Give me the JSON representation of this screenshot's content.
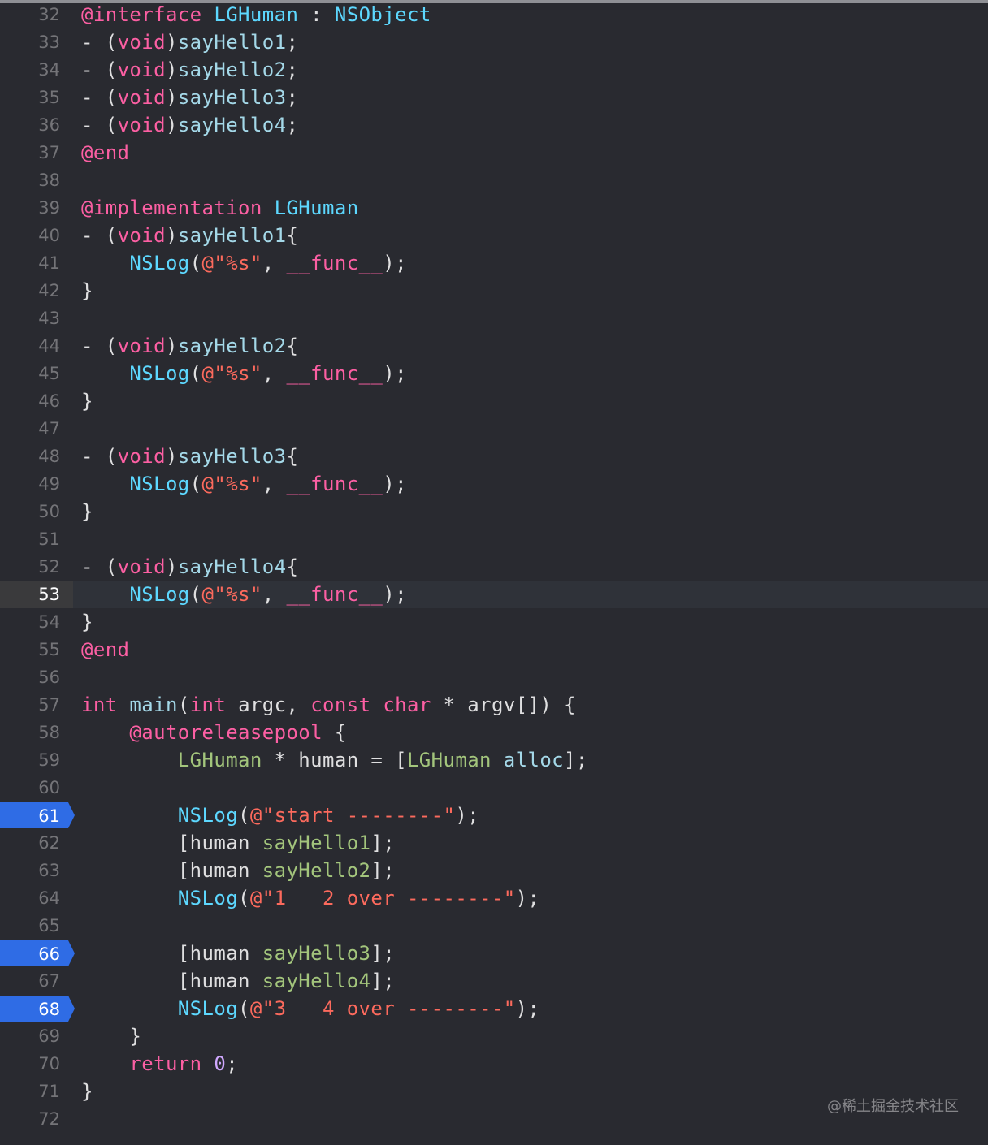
{
  "editor": {
    "current_line": 53,
    "breakpoint_lines": [
      61,
      66,
      68
    ],
    "lines": [
      {
        "n": "32",
        "tokens": [
          [
            "kw",
            "@interface"
          ],
          [
            "p",
            " "
          ],
          [
            "lg",
            "LGHuman"
          ],
          [
            "p",
            " : "
          ],
          [
            "cls",
            "NSObject"
          ]
        ]
      },
      {
        "n": "33",
        "tokens": [
          [
            "p",
            "- ("
          ],
          [
            "kw",
            "void"
          ],
          [
            "p",
            ")"
          ],
          [
            "meth",
            "sayHello1"
          ],
          [
            "p",
            ";"
          ]
        ]
      },
      {
        "n": "34",
        "tokens": [
          [
            "p",
            "- ("
          ],
          [
            "kw",
            "void"
          ],
          [
            "p",
            ")"
          ],
          [
            "meth",
            "sayHello2"
          ],
          [
            "p",
            ";"
          ]
        ]
      },
      {
        "n": "35",
        "tokens": [
          [
            "p",
            "- ("
          ],
          [
            "kw",
            "void"
          ],
          [
            "p",
            ")"
          ],
          [
            "meth",
            "sayHello3"
          ],
          [
            "p",
            ";"
          ]
        ]
      },
      {
        "n": "36",
        "tokens": [
          [
            "p",
            "- ("
          ],
          [
            "kw",
            "void"
          ],
          [
            "p",
            ")"
          ],
          [
            "meth",
            "sayHello4"
          ],
          [
            "p",
            ";"
          ]
        ]
      },
      {
        "n": "37",
        "tokens": [
          [
            "kw",
            "@end"
          ]
        ]
      },
      {
        "n": "38",
        "tokens": []
      },
      {
        "n": "39",
        "tokens": [
          [
            "kw",
            "@implementation"
          ],
          [
            "p",
            " "
          ],
          [
            "lg",
            "LGHuman"
          ]
        ]
      },
      {
        "n": "40",
        "tokens": [
          [
            "p",
            "- ("
          ],
          [
            "kw",
            "void"
          ],
          [
            "p",
            ")"
          ],
          [
            "meth",
            "sayHello1"
          ],
          [
            "p",
            "{"
          ]
        ]
      },
      {
        "n": "41",
        "tokens": [
          [
            "p",
            "    "
          ],
          [
            "cls",
            "NSLog"
          ],
          [
            "p",
            "("
          ],
          [
            "str",
            "@\"%s\""
          ],
          [
            "p",
            ", "
          ],
          [
            "kw",
            "__func__"
          ],
          [
            "p",
            ");"
          ]
        ]
      },
      {
        "n": "42",
        "tokens": [
          [
            "p",
            "}"
          ]
        ]
      },
      {
        "n": "43",
        "tokens": []
      },
      {
        "n": "44",
        "tokens": [
          [
            "p",
            "- ("
          ],
          [
            "kw",
            "void"
          ],
          [
            "p",
            ")"
          ],
          [
            "meth",
            "sayHello2"
          ],
          [
            "p",
            "{"
          ]
        ]
      },
      {
        "n": "45",
        "tokens": [
          [
            "p",
            "    "
          ],
          [
            "cls",
            "NSLog"
          ],
          [
            "p",
            "("
          ],
          [
            "str",
            "@\"%s\""
          ],
          [
            "p",
            ", "
          ],
          [
            "kw",
            "__func__"
          ],
          [
            "p",
            ");"
          ]
        ]
      },
      {
        "n": "46",
        "tokens": [
          [
            "p",
            "}"
          ]
        ]
      },
      {
        "n": "47",
        "tokens": []
      },
      {
        "n": "48",
        "tokens": [
          [
            "p",
            "- ("
          ],
          [
            "kw",
            "void"
          ],
          [
            "p",
            ")"
          ],
          [
            "meth",
            "sayHello3"
          ],
          [
            "p",
            "{"
          ]
        ]
      },
      {
        "n": "49",
        "tokens": [
          [
            "p",
            "    "
          ],
          [
            "cls",
            "NSLog"
          ],
          [
            "p",
            "("
          ],
          [
            "str",
            "@\"%s\""
          ],
          [
            "p",
            ", "
          ],
          [
            "kw",
            "__func__"
          ],
          [
            "p",
            ");"
          ]
        ]
      },
      {
        "n": "50",
        "tokens": [
          [
            "p",
            "}"
          ]
        ]
      },
      {
        "n": "51",
        "tokens": []
      },
      {
        "n": "52",
        "tokens": [
          [
            "p",
            "- ("
          ],
          [
            "kw",
            "void"
          ],
          [
            "p",
            ")"
          ],
          [
            "meth",
            "sayHello4"
          ],
          [
            "p",
            "{"
          ]
        ]
      },
      {
        "n": "53",
        "tokens": [
          [
            "p",
            "    "
          ],
          [
            "cls",
            "NSLog"
          ],
          [
            "p",
            "("
          ],
          [
            "str",
            "@\"%s\""
          ],
          [
            "p",
            ", "
          ],
          [
            "kw",
            "__func__"
          ],
          [
            "p",
            ");"
          ]
        ]
      },
      {
        "n": "54",
        "tokens": [
          [
            "p",
            "}"
          ]
        ]
      },
      {
        "n": "55",
        "tokens": [
          [
            "kw",
            "@end"
          ]
        ]
      },
      {
        "n": "56",
        "tokens": []
      },
      {
        "n": "57",
        "tokens": [
          [
            "kw",
            "int"
          ],
          [
            "p",
            " "
          ],
          [
            "meth",
            "main"
          ],
          [
            "p",
            "("
          ],
          [
            "kw",
            "int"
          ],
          [
            "p",
            " argc, "
          ],
          [
            "kw",
            "const"
          ],
          [
            "p",
            " "
          ],
          [
            "kw",
            "char"
          ],
          [
            "p",
            " * argv[]) {"
          ]
        ]
      },
      {
        "n": "58",
        "tokens": [
          [
            "p",
            "    "
          ],
          [
            "kw",
            "@autoreleasepool"
          ],
          [
            "p",
            " {"
          ]
        ]
      },
      {
        "n": "59",
        "tokens": [
          [
            "p",
            "        "
          ],
          [
            "obj",
            "LGHuman"
          ],
          [
            "p",
            " * human = ["
          ],
          [
            "obj",
            "LGHuman"
          ],
          [
            "p",
            " "
          ],
          [
            "meth",
            "alloc"
          ],
          [
            "p",
            "];"
          ]
        ]
      },
      {
        "n": "60",
        "tokens": []
      },
      {
        "n": "61",
        "tokens": [
          [
            "p",
            "        "
          ],
          [
            "cls",
            "NSLog"
          ],
          [
            "p",
            "("
          ],
          [
            "str",
            "@\"start --------\""
          ],
          [
            "p",
            ");"
          ]
        ]
      },
      {
        "n": "62",
        "tokens": [
          [
            "p",
            "        [human "
          ],
          [
            "obj",
            "sayHello1"
          ],
          [
            "p",
            "];"
          ]
        ]
      },
      {
        "n": "63",
        "tokens": [
          [
            "p",
            "        [human "
          ],
          [
            "obj",
            "sayHello2"
          ],
          [
            "p",
            "];"
          ]
        ]
      },
      {
        "n": "64",
        "tokens": [
          [
            "p",
            "        "
          ],
          [
            "cls",
            "NSLog"
          ],
          [
            "p",
            "("
          ],
          [
            "str",
            "@\"1   2 over --------\""
          ],
          [
            "p",
            ");"
          ]
        ]
      },
      {
        "n": "65",
        "tokens": []
      },
      {
        "n": "66",
        "tokens": [
          [
            "p",
            "        [human "
          ],
          [
            "obj",
            "sayHello3"
          ],
          [
            "p",
            "];"
          ]
        ]
      },
      {
        "n": "67",
        "tokens": [
          [
            "p",
            "        [human "
          ],
          [
            "obj",
            "sayHello4"
          ],
          [
            "p",
            "];"
          ]
        ]
      },
      {
        "n": "68",
        "tokens": [
          [
            "p",
            "        "
          ],
          [
            "cls",
            "NSLog"
          ],
          [
            "p",
            "("
          ],
          [
            "str",
            "@\"3   4 over --------\""
          ],
          [
            "p",
            ");"
          ]
        ]
      },
      {
        "n": "69",
        "tokens": [
          [
            "p",
            "    }"
          ]
        ]
      },
      {
        "n": "70",
        "tokens": [
          [
            "p",
            "    "
          ],
          [
            "kw",
            "return"
          ],
          [
            "p",
            " "
          ],
          [
            "type",
            "0"
          ],
          [
            "p",
            ";"
          ]
        ]
      },
      {
        "n": "71",
        "tokens": [
          [
            "p",
            "}"
          ]
        ]
      },
      {
        "n": "72",
        "tokens": []
      }
    ]
  },
  "watermark": "@稀土掘金技术社区",
  "colors": {
    "background": "#292a30",
    "keyword": "#fc5fa3",
    "class": "#5dd8ff",
    "string": "#fc6a5d",
    "method": "#a4d8e8",
    "project_symbol": "#a3c57c",
    "breakpoint": "#2f6ce5"
  }
}
